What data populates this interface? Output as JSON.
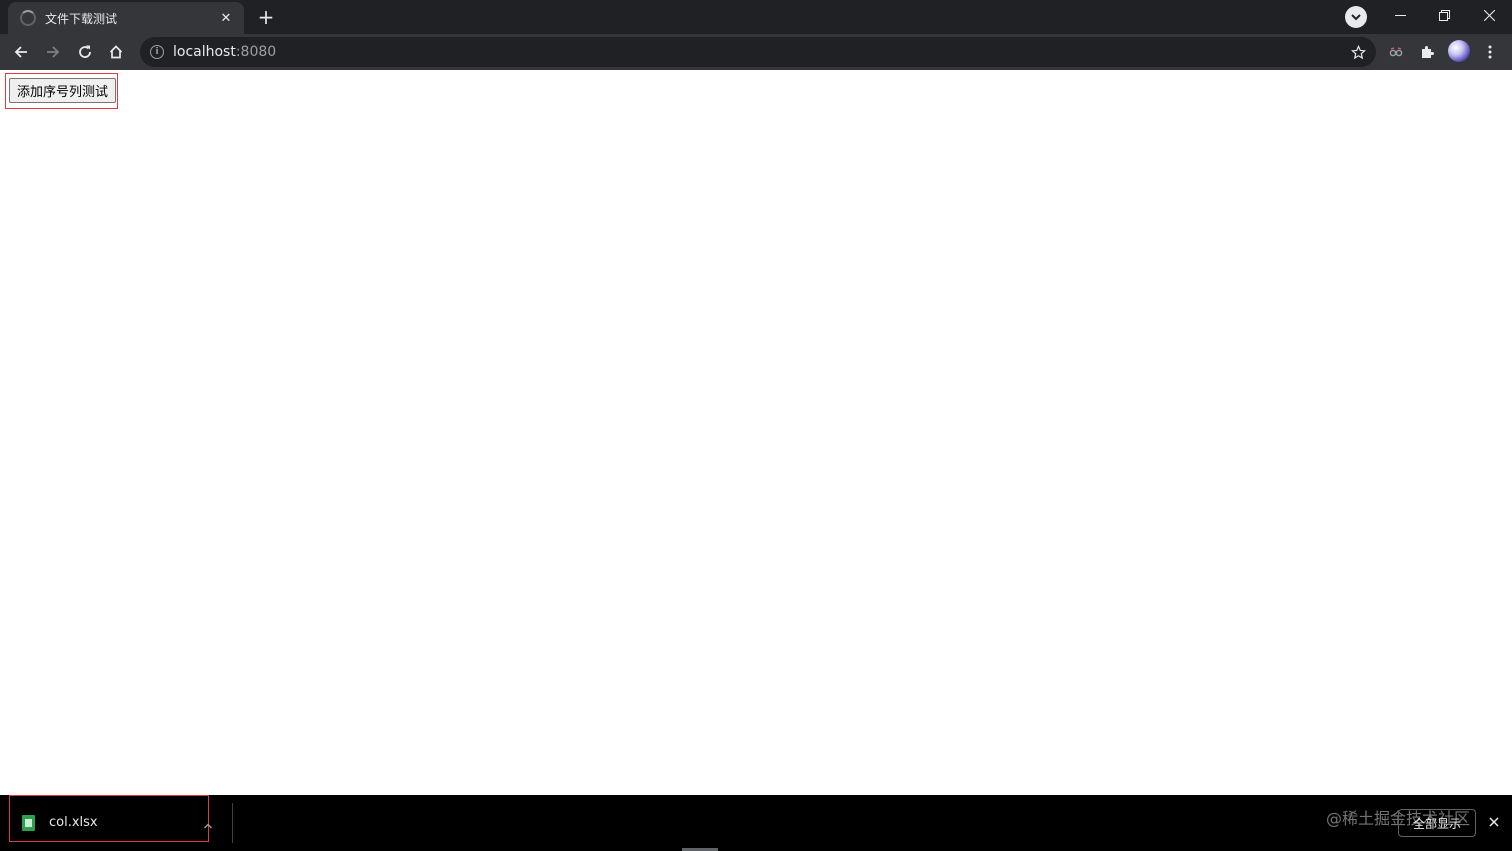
{
  "browser": {
    "tab": {
      "title": "文件下载测试",
      "close_glyph": "✕"
    },
    "new_tab_glyph": "+",
    "address": {
      "host": "localhost",
      "port": ":8080",
      "info_glyph": "i"
    }
  },
  "page": {
    "button_label": "添加序号列测试",
    "highlight_color": "#e0393e"
  },
  "downloads": {
    "items": [
      {
        "filename": "col.xlsx",
        "icon": "spreadsheet-file-icon"
      }
    ],
    "show_all_label": "全部显示"
  },
  "watermark": "@稀土掘金技术社区",
  "colors": {
    "tabstrip_bg": "#202124",
    "toolbar_bg": "#35363a",
    "omnibox_bg": "#202124",
    "shelf_bg": "#000000",
    "text_light": "#e8eaed",
    "text_muted": "#9aa0a6"
  }
}
